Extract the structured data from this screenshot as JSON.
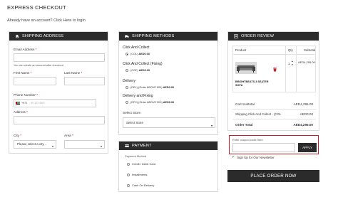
{
  "page": {
    "title": "EXPRESS CHECKOUT",
    "login_prompt": "Already have an account? Click Here to login"
  },
  "shipping_address": {
    "header": "SHIPPING ADDRESS",
    "email_label": "Email Address",
    "required_mark": "*",
    "email_note": "You can create an account after checkout.",
    "first_name_label": "First Name",
    "last_name_label": "Last Name",
    "phone_label": "Phone Number",
    "phone_code": "+971",
    "phone_placeholder": "50 123 4567",
    "address_label": "Address",
    "city_label": "City",
    "city_value": "Please select a city...",
    "area_label": "Area"
  },
  "shipping_methods": {
    "header": "SHIPPING METHODS",
    "groups": [
      {
        "title": "Click And Collect",
        "option_code": "(COL)",
        "option_price": "AED0.00",
        "selected": true
      },
      {
        "title": "Click And Collect (Fixing)",
        "option_code": "(COF)",
        "option_price": "AED0.00",
        "selected": false
      },
      {
        "title": "Delivery",
        "option_code": "(DEL) (Order ABOVE 500)",
        "option_price": "AED0.00",
        "selected": false
      },
      {
        "title": "Delivery and Fixing",
        "option_code": "(DFX) (Order ABOVE 500)",
        "option_price": "AED0.00",
        "selected": false
      }
    ],
    "store_label": "Select Store",
    "store_value": "Select Store"
  },
  "payment": {
    "header": "PAYMENT",
    "method_label": "Payment Method",
    "options": [
      "Credit / Debit Card",
      "Installments",
      "Cash On Delivery"
    ]
  },
  "order_review": {
    "header": "ORDER REVIEW",
    "col_product": "Product",
    "col_qty": "Qty",
    "col_subtotal": "Subtotal",
    "product_name": "BRIGHTBEATS 3 SEATER SOFA",
    "product_qty": "1",
    "product_subtotal": "AED4,295.00",
    "cart_subtotal_label": "Cart Subtotal",
    "cart_subtotal_value": "AED4,295.00",
    "shipping_label": "Shipping Click And Collect - (COL",
    "shipping_value": "AED0.00",
    "order_total_label": "Order Total",
    "order_total_value": "AED4,295.00",
    "coupon_label": "Enter coupon code here",
    "apply_label": "APPLY",
    "newsletter_label": "Sign Up for Our Newsletter",
    "place_order_label": "PLACE ORDER NOW"
  },
  "colors": {
    "header_bg": "#2b2b2b",
    "coupon_border": "#c0202a",
    "check_green": "#3a9a3a"
  }
}
